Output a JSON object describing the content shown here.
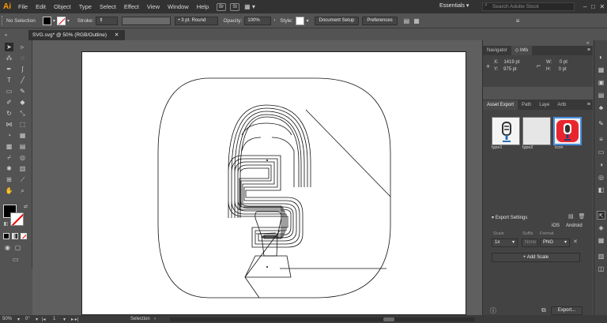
{
  "app": {
    "logo": "Ai"
  },
  "menubar": {
    "items": [
      "File",
      "Edit",
      "Object",
      "Type",
      "Select",
      "Effect",
      "View",
      "Window",
      "Help"
    ],
    "bridge_label": "Br",
    "stock_label": "St",
    "workspace": "Essentials",
    "search_placeholder": "Search Adobe Stock"
  },
  "control": {
    "selection_label": "No Selection",
    "stroke_label": "Stroke:",
    "brush_value": "3 pt. Round",
    "opacity_label": "Opacity:",
    "opacity_value": "100%",
    "style_label": "Style:",
    "doc_setup_button": "Document Setup",
    "prefs_button": "Preferences"
  },
  "document": {
    "tab_title": "SVG.svg* @ 50% (RGB/Outline)"
  },
  "info_panel": {
    "tabs": [
      "Navigator",
      "Info"
    ],
    "x_label": "X:",
    "x_value": "1419 pt",
    "y_label": "Y:",
    "y_value": "975 pt",
    "w_label": "W:",
    "w_value": "0 pt",
    "h_label": "H:",
    "h_value": "0 pt"
  },
  "asset_panel": {
    "tabs": [
      "Asset Export",
      "Path",
      "Laye",
      "Artb"
    ],
    "assets": [
      "type1",
      "type2",
      "Icon"
    ],
    "export_settings_label": "Export Settings",
    "ios_label": "iOS",
    "android_label": "Android",
    "scale_header": "Scale",
    "suffix_header": "Suffix",
    "format_header": "Format",
    "scale_value": "1x",
    "suffix_placeholder": "None",
    "format_value": "PNG",
    "add_scale_label": "+ Add Scale",
    "export_button": "Export..."
  },
  "status": {
    "zoom": "50%",
    "rotation": "0°",
    "artboard": "1",
    "tool": "Selection"
  },
  "colors": {
    "logo": "#ff9a00",
    "icon_red": "#e8252e",
    "dark_ui": "#323232",
    "panel": "#535353"
  }
}
